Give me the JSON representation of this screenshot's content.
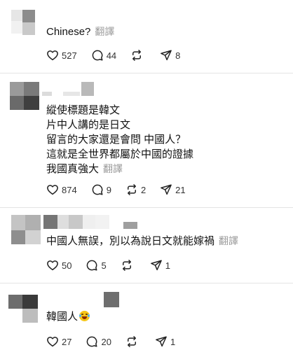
{
  "translate_label": "翻譯",
  "comments": [
    {
      "lines": [
        "Chinese?"
      ],
      "likes": "527",
      "replies": "44",
      "reposts": "",
      "shares": "8"
    },
    {
      "lines": [
        "縱使標題是韓文",
        "片中人講的是日文",
        "留言的大家還是會問 中國人？",
        "這就是全世界都屬於中國的證據",
        "我國真強大"
      ],
      "likes": "874",
      "replies": "9",
      "reposts": "2",
      "shares": "21"
    },
    {
      "lines": [
        "中國人無誤，別以為說日文就能嫁禍"
      ],
      "likes": "50",
      "replies": "5",
      "reposts": "",
      "shares": "1"
    },
    {
      "lines": [
        "韓國人"
      ],
      "emoji": "grinning-sweat-tears-emoji",
      "likes": "27",
      "replies": "20",
      "reposts": "",
      "shares": "1"
    }
  ],
  "colors": {
    "text": "#111111",
    "muted": "#9a9a9a",
    "divider": "#e4e4e4"
  }
}
